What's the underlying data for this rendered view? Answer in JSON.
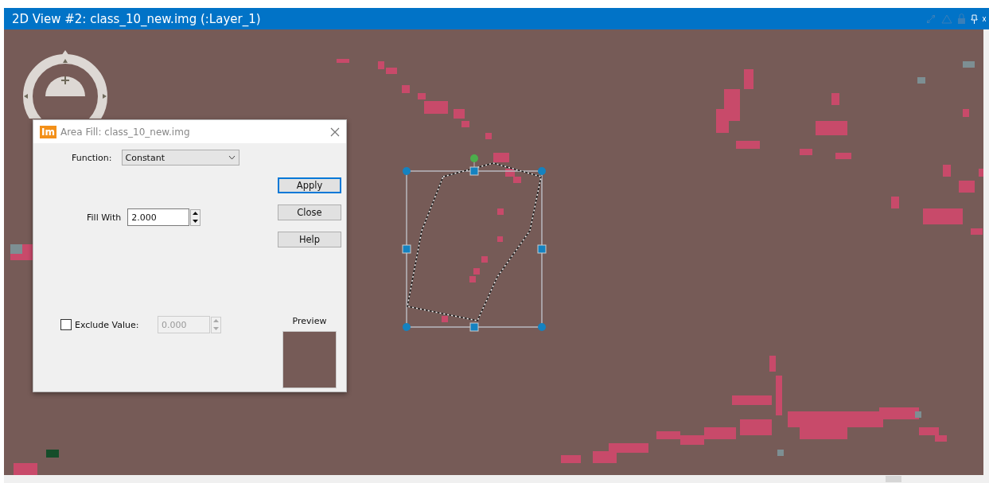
{
  "window": {
    "title": "2D View #2: class_10_new.img (:Layer_1)"
  },
  "dialog": {
    "title": "Area Fill: class_10_new.img",
    "app_badge": "Im",
    "function": {
      "label": "Function:",
      "value": "Constant"
    },
    "fill_with": {
      "label": "Fill With",
      "value": "2.000"
    },
    "exclude": {
      "label": "Exclude Value:",
      "checked": false,
      "value": "0.000",
      "disabled": true
    },
    "buttons": [
      {
        "label": "Apply",
        "selected": true
      },
      {
        "label": "Close",
        "selected": false
      },
      {
        "label": "Help",
        "selected": false
      }
    ],
    "preview": {
      "label": "Preview"
    }
  }
}
